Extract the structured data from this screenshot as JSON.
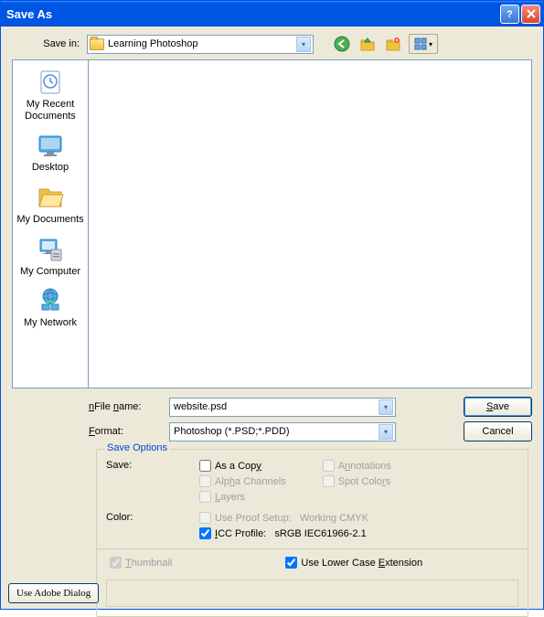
{
  "title": "Save As",
  "toolbar": {
    "save_in_label": "Save in:",
    "folder_name": "Learning Photoshop"
  },
  "sidebar": [
    {
      "label": "My Recent Documents"
    },
    {
      "label": "Desktop"
    },
    {
      "label": "My Documents"
    },
    {
      "label": "My Computer"
    },
    {
      "label": "My Network"
    }
  ],
  "file_row": {
    "label": "File name:",
    "value": "website.psd"
  },
  "format_row": {
    "label": "Format:",
    "value": "Photoshop (*.PSD;*.PDD)"
  },
  "buttons": {
    "save": "Save",
    "cancel": "Cancel",
    "use_adobe": "Use Adobe Dialog"
  },
  "save_options": {
    "title": "Save Options",
    "save_label": "Save:",
    "as_copy": "As a Copy",
    "annotations": "Annotations",
    "alpha": "Alpha Channels",
    "spot": "Spot Colors",
    "layers": "Layers",
    "color_label": "Color:",
    "proof": "Use Proof Setup:   Working CMYK",
    "icc": "ICC Profile:   sRGB IEC61966-2.1",
    "thumbnail": "Thumbnail",
    "lowercase": "Use Lower Case Extension"
  }
}
